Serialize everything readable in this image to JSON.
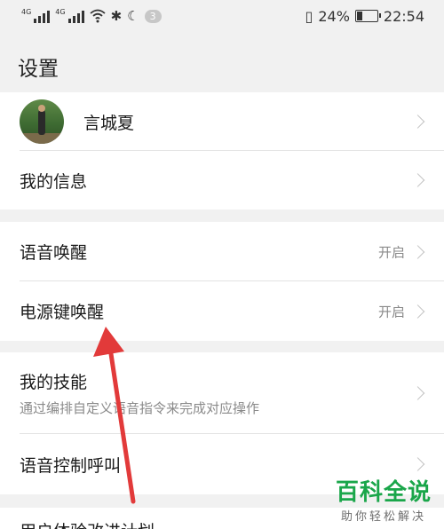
{
  "status_bar": {
    "signal1_tag": "4G",
    "signal2_tag": "4G",
    "notification_count": "3",
    "battery": "24%",
    "time": "22:54"
  },
  "page": {
    "title": "设置"
  },
  "profile": {
    "name": "言城夏"
  },
  "groups": {
    "account": {
      "my_info": "我的信息"
    },
    "wake": {
      "voice_wake": {
        "label": "语音唤醒",
        "value": "开启"
      },
      "power_key_wake": {
        "label": "电源键唤醒",
        "value": "开启"
      }
    },
    "skills": {
      "my_skills": {
        "label": "我的技能",
        "desc": "通过编排自定义语音指令来完成对应操作"
      },
      "voice_call": {
        "label": "语音控制呼叫"
      },
      "partial_row": {
        "label": "用户体验改进计划"
      }
    }
  },
  "watermark": {
    "title": "百科全说",
    "subtitle": "助你轻松解决"
  },
  "colors": {
    "annotation_arrow": "#e23a3a",
    "watermark_green": "#1aa64a"
  }
}
